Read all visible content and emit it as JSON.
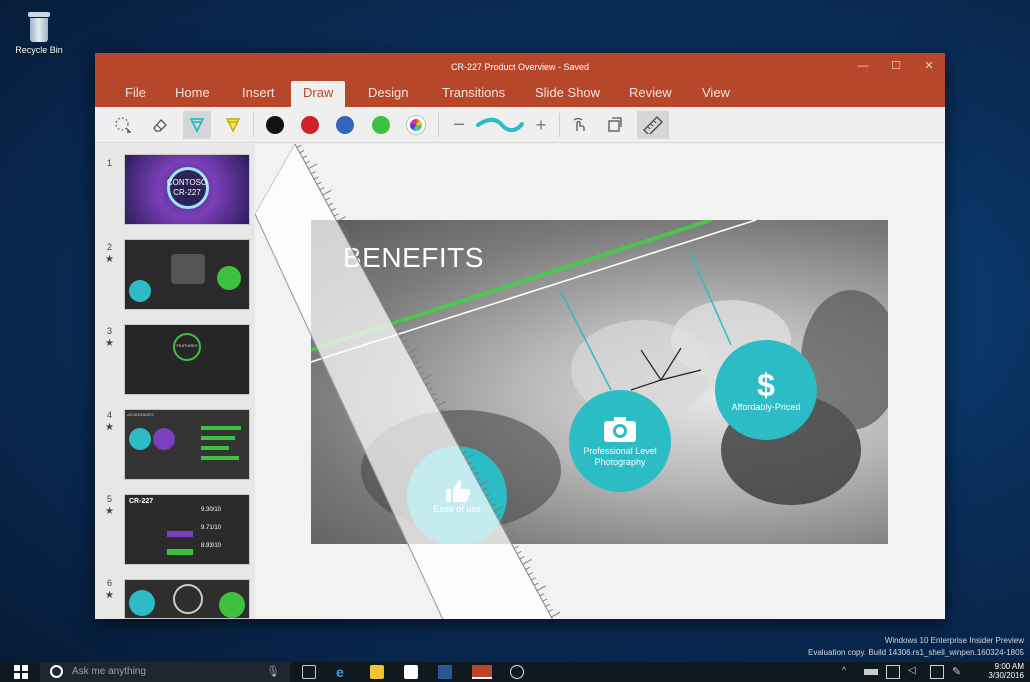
{
  "desktop": {
    "recycle_bin_label": "Recycle Bin",
    "watermark_line1": "Windows 10 Enterprise Insider Preview",
    "watermark_line2": "Evaluation copy. Build 14306.rs1_shell_winpen.160324-1805"
  },
  "window": {
    "title": "CR-227 Product Overview - Saved",
    "tabs": [
      "File",
      "Home",
      "Insert",
      "Draw",
      "Design",
      "Transitions",
      "Slide Show",
      "Review",
      "View"
    ],
    "active_tab": "Draw"
  },
  "toolbar": {
    "tools": [
      "lasso-select-icon",
      "eraser-icon",
      "pen-icon",
      "highlighter-icon",
      "black-ink",
      "red-ink",
      "blue-ink",
      "green-ink",
      "more-colors",
      "thickness-decrease",
      "ink-thickness",
      "thickness-increase",
      "touch-drawing-icon",
      "ink-to-shape-icon",
      "ruler-icon"
    ],
    "colors": {
      "black": "#111111",
      "red": "#d0202a",
      "blue": "#3465b8",
      "green": "#3ec13e",
      "accent": "#2bbcc5"
    },
    "minus": "−",
    "plus": "+"
  },
  "slides": [
    {
      "num": "1",
      "starred": false,
      "text": "CONTOSO\nCR-227"
    },
    {
      "num": "2",
      "starred": true,
      "text": ""
    },
    {
      "num": "3",
      "starred": true,
      "text": "FEATURES"
    },
    {
      "num": "4",
      "starred": true,
      "text": "ADVANTAGES"
    },
    {
      "num": "5",
      "starred": true,
      "text": "CR-227"
    },
    {
      "num": "6",
      "starred": true,
      "text": ""
    }
  ],
  "star_glyph": "★",
  "thumb1": {
    "line1": "CONTOSO",
    "line2": "CR-227"
  },
  "thumb3": {
    "label": "FEATURES"
  },
  "thumb4": {
    "label": "ADVANTAGES"
  },
  "thumb5": {
    "label": "CR-227",
    "v1": "9.30/10",
    "v2": "9.71/10",
    "v3": "8.93/10"
  },
  "slide": {
    "title": "BENEFITS",
    "circles": [
      {
        "label": "Ease of use"
      },
      {
        "label": "Professional Level Photography"
      },
      {
        "label": "Affordably-Priced",
        "glyph": "$"
      }
    ]
  },
  "taskbar": {
    "search_placeholder": "Ask me anything",
    "time": "9:00 AM",
    "date": "3/30/2016"
  }
}
